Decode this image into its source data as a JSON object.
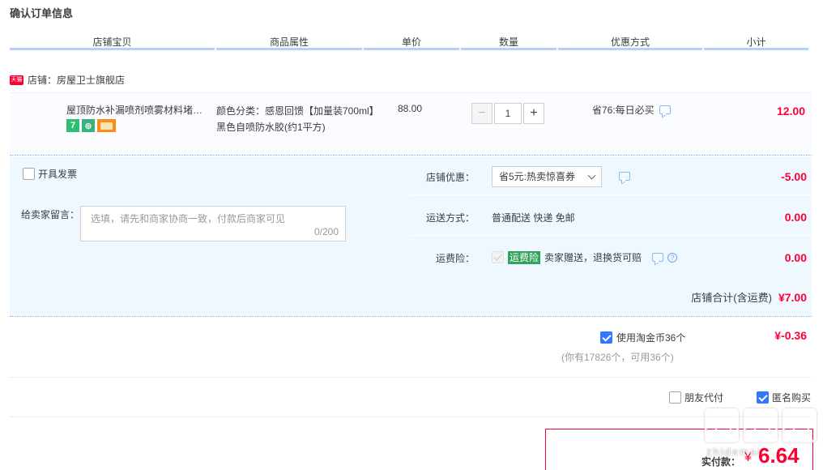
{
  "page": {
    "title": "确认订单信息"
  },
  "columns": [
    "店铺宝贝",
    "商品属性",
    "单价",
    "数量",
    "优惠方式",
    "小计"
  ],
  "shop": {
    "badge": "天猫",
    "label": "店铺：房屋卫士旗舰店"
  },
  "item": {
    "title": "屋顶防水补漏喷剂喷雾材料堵漏王外墙涂料楼顶裂缝卫生间胶神器",
    "attributes": "颜色分类：感恩回馈【加量装700ml】黑色自喷防水胶(约1平方)",
    "price": "88.00",
    "quantity": "1",
    "promo": "省76:每日必买",
    "subtotal": "12.00"
  },
  "invoice": {
    "label": "开具发票",
    "checked": false
  },
  "message": {
    "label": "给卖家留言：",
    "placeholder": "选填，请先和商家协商一致，付款后商家可见",
    "counter": "0/200"
  },
  "shop_discount": {
    "label": "店铺优惠：",
    "selected": "省5元:热卖惊喜券",
    "amount": "-5.00"
  },
  "delivery": {
    "label": "运送方式：",
    "value": "普通配送 快递 免邮",
    "amount": "0.00"
  },
  "insurance": {
    "label": "运费险：",
    "tag": "运费险",
    "text": "卖家赠送，退换货可赔",
    "amount": "0.00"
  },
  "shop_total": {
    "label": "店铺合计(含运费)",
    "amount": "¥7.00"
  },
  "coins": {
    "label": "使用淘金币36个",
    "checked": true,
    "amount": "¥-0.36",
    "note": "(你有17826个，可用36个)"
  },
  "options": {
    "friend_pay": {
      "label": "朋友代付",
      "checked": false
    },
    "anonymous": {
      "label": "匿名购买",
      "checked": true
    }
  },
  "payment": {
    "label": "实付款：",
    "currency": "¥",
    "amount": "6.64"
  },
  "watermark": {
    "text": "zhidemai"
  },
  "colors": {
    "accent": "#ff0036",
    "header_line": "#b2d1ff",
    "panel_bg": "#f0f8ff",
    "checkbox": "#3377ff"
  }
}
